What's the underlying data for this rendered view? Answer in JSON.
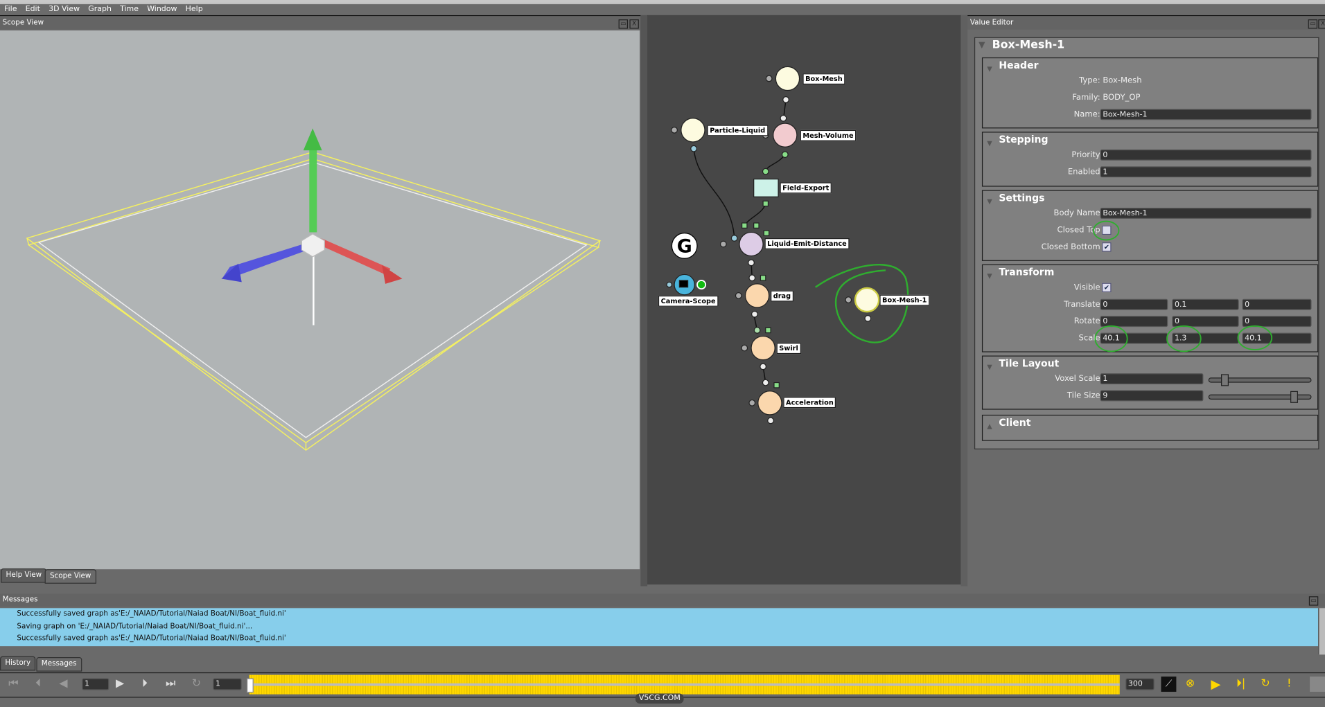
{
  "menubar": {
    "items": [
      "File",
      "Edit",
      "3D View",
      "Graph",
      "Time",
      "Window",
      "Help"
    ]
  },
  "scope_view": {
    "title": "Scope View",
    "tabs": [
      "Help View",
      "Scope View"
    ],
    "background": "#b0b4b5",
    "wireframe_color": "#f4f060"
  },
  "node_graph": {
    "background": "#474747",
    "nodes": [
      {
        "label": "Box-Mesh",
        "color": "#fdfbe0"
      },
      {
        "label": "Mesh-Volume",
        "color": "#f2cbcf"
      },
      {
        "label": "Particle-Liquid",
        "color": "#fdfbe0"
      },
      {
        "label": "Field-Export",
        "color": "#cdf2e8"
      },
      {
        "label": "Liquid-Emit-Distance",
        "color": "#ddcce6"
      },
      {
        "label": "drag",
        "color": "#fbd7ad"
      },
      {
        "label": "Swirl",
        "color": "#fbd7ad"
      },
      {
        "label": "Acceleration",
        "color": "#fbd7ad"
      },
      {
        "label": "Box-Mesh-1",
        "color": "#fdfbe0"
      },
      {
        "label": "Camera-Scope",
        "color": "#49b4dc"
      }
    ],
    "global_icon": "G"
  },
  "value_editor": {
    "title": "Value Editor",
    "object_name": "Box-Mesh-1",
    "header": {
      "title": "Header",
      "type_label": "Type:",
      "type": "Box-Mesh",
      "family_label": "Family:",
      "family": "BODY_OP",
      "name_label": "Name:",
      "name": "Box-Mesh-1"
    },
    "stepping": {
      "title": "Stepping",
      "priority_label": "Priority",
      "priority": "0",
      "enabled_label": "Enabled",
      "enabled": "1"
    },
    "settings": {
      "title": "Settings",
      "body_name_label": "Body Name",
      "body_name": "Box-Mesh-1",
      "closed_top_label": "Closed Top",
      "closed_top": false,
      "closed_bottom_label": "Closed Bottom",
      "closed_bottom": true
    },
    "transform": {
      "title": "Transform",
      "visible_label": "Visible",
      "visible": true,
      "translate_label": "Translate",
      "translate": [
        "0",
        "0.1",
        "0"
      ],
      "rotate_label": "Rotate",
      "rotate": [
        "0",
        "0",
        "0"
      ],
      "scale_label": "Scale",
      "scale": [
        "40.1",
        "1.3",
        "40.1"
      ]
    },
    "tile_layout": {
      "title": "Tile Layout",
      "voxel_scale_label": "Voxel Scale",
      "voxel_scale": "1",
      "tile_size_label": "Tile Size",
      "tile_size": "9"
    },
    "client": {
      "title": "Client"
    }
  },
  "messages": {
    "title": "Messages",
    "items": [
      "Successfully saved graph as'E:/_NAIAD/Tutorial/Naiad Boat/NI/Boat_fluid.ni'",
      "Saving graph on 'E:/_NAIAD/Tutorial/Naiad Boat/NI/Boat_fluid.ni'...",
      "Successfully saved graph as'E:/_NAIAD/Tutorial/Naiad Boat/NI/Boat_fluid.ni'"
    ],
    "background": "#87ceeb",
    "tabs": [
      "History",
      "Messages"
    ]
  },
  "timeline": {
    "current_frame": "1",
    "start_frame": "1",
    "end_frame": "300",
    "accent": "#ffd700"
  },
  "watermark": "V5CG.COM"
}
